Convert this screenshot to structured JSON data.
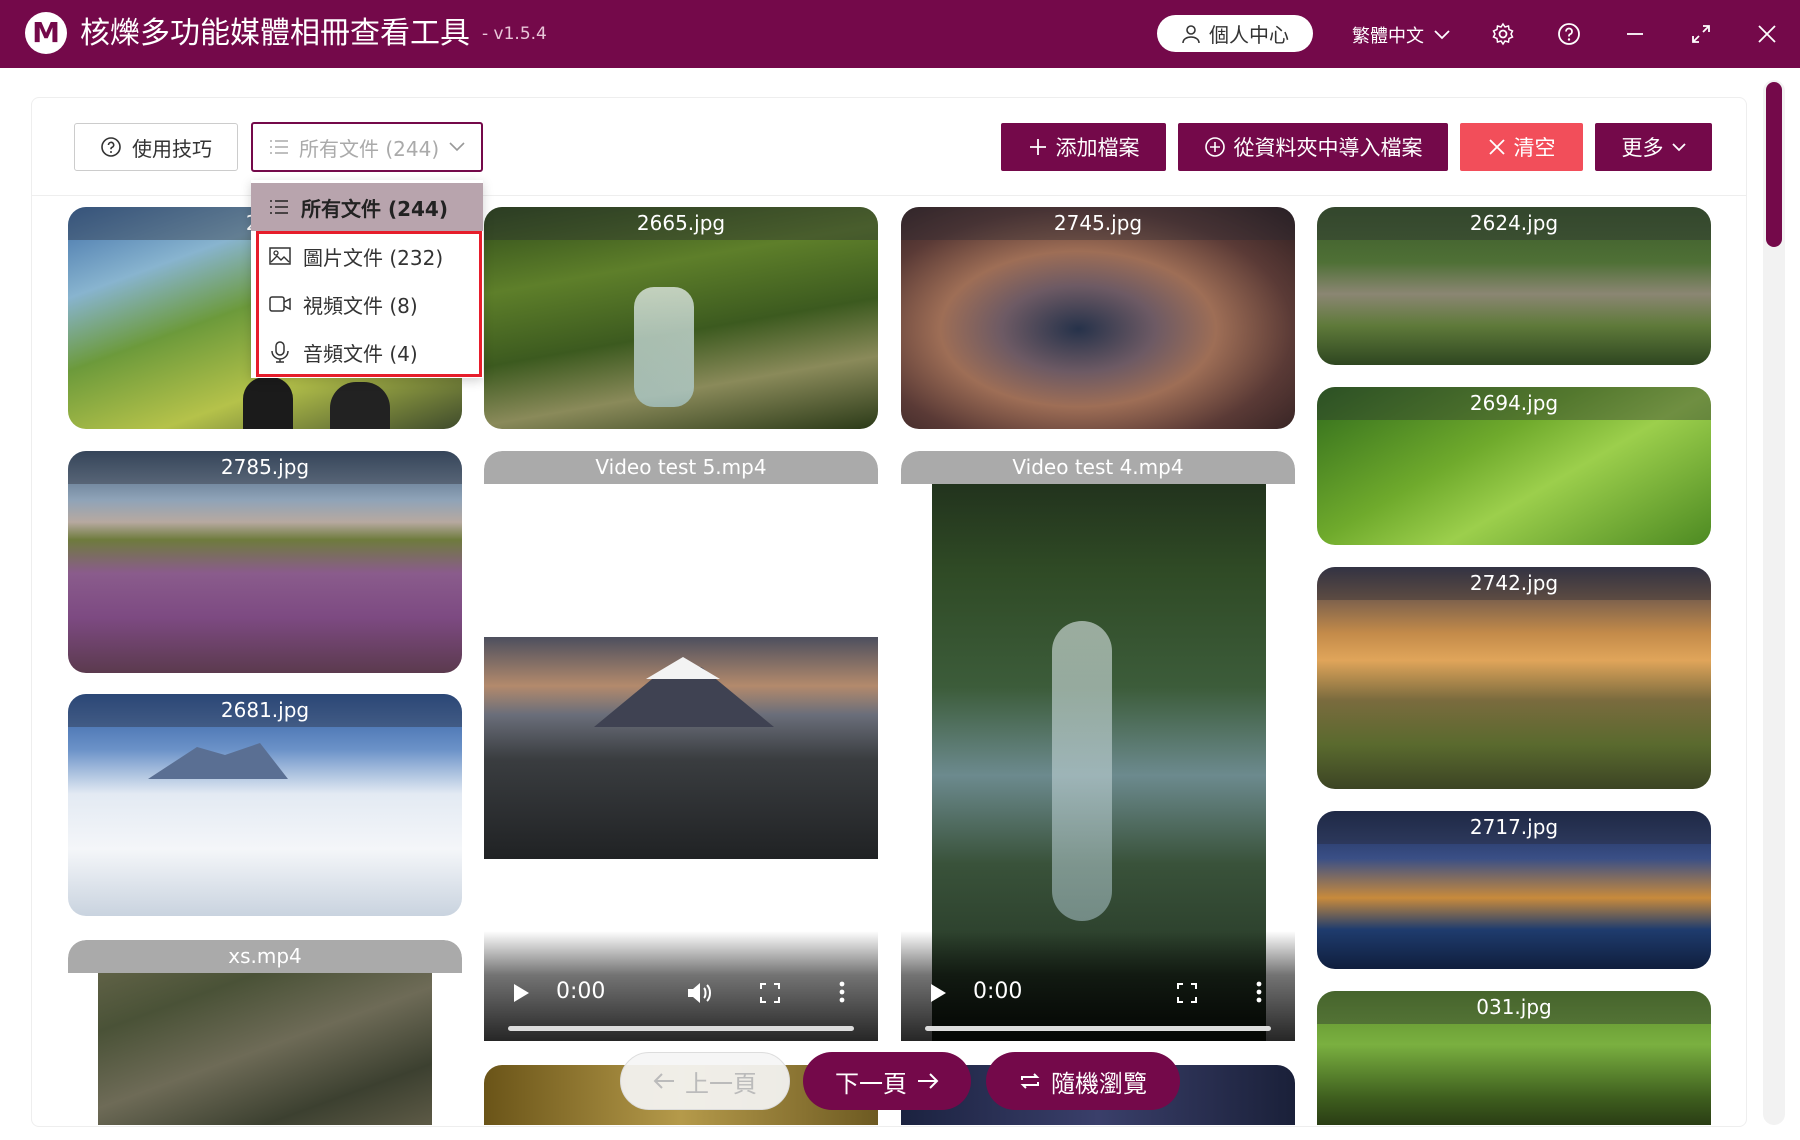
{
  "window": {
    "title": "核爍多功能媒體相冊查看工具",
    "version": "- v1.5.4",
    "logo_letter": "M",
    "account_label": "個人中心",
    "language_label": "繁體中文"
  },
  "toolbar": {
    "tips_label": "使用技巧",
    "filter_placeholder": "所有文件 (244)",
    "add_file_label": "添加檔案",
    "import_folder_label": "從資料夾中導入檔案",
    "clear_label": "清空",
    "more_label": "更多"
  },
  "filter_menu": {
    "items": [
      {
        "label": "所有文件 (244)",
        "icon": "list-icon",
        "selected": true
      },
      {
        "label": "圖片文件 (232)",
        "icon": "image-icon",
        "selected": false
      },
      {
        "label": "視頻文件 (8)",
        "icon": "video-icon",
        "selected": false
      },
      {
        "label": "音頻文件 (4)",
        "icon": "microphone-icon",
        "selected": false
      }
    ]
  },
  "gallery": {
    "col1": [
      "265",
      "2785.jpg",
      "2681.jpg",
      "xs.mp4"
    ],
    "col2": [
      "2665.jpg",
      "Video test 5.mp4"
    ],
    "col3": [
      "2745.jpg",
      "Video test 4.mp4"
    ],
    "col4": [
      "2624.jpg",
      "2694.jpg",
      "2742.jpg",
      "2717.jpg",
      "031.jpg"
    ],
    "video_time": "0:00"
  },
  "pager": {
    "prev_label": "上一頁",
    "next_label": "下一頁",
    "random_label": "隨機瀏覽"
  },
  "colors": {
    "brand": "#74094a",
    "danger": "#f24e5a",
    "highlight": "#e61d2b"
  }
}
